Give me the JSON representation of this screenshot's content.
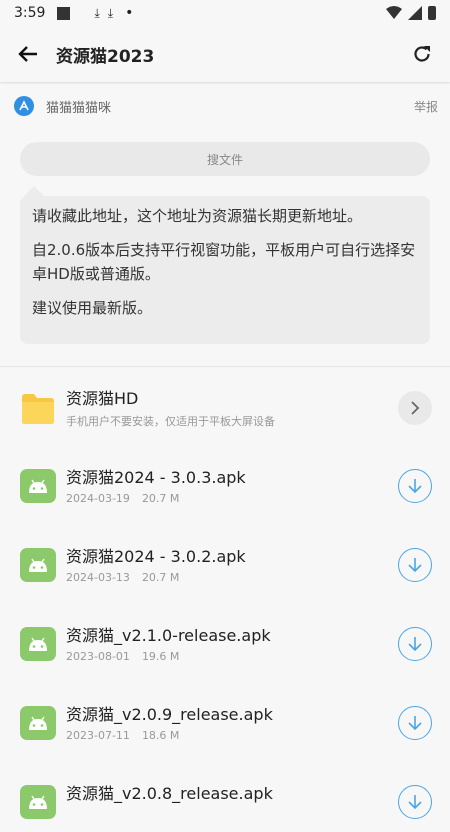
{
  "status_bar": {
    "time": "3:59",
    "dl1": "⤓",
    "dl2": "⤓",
    "dot": "•"
  },
  "appbar": {
    "title": "资源猫2023"
  },
  "author": {
    "name": "猫猫猫猫咪",
    "report": "举报"
  },
  "search": {
    "placeholder": "搜文件"
  },
  "notice": {
    "p1": "请收藏此地址，这个地址为资源猫长期更新地址。",
    "p2": "自2.0.6版本后支持平行视窗功能，平板用户可自行选择安卓HD版或普通版。",
    "p3": "建议使用最新版。"
  },
  "folder": {
    "name": "资源猫HD",
    "desc": "手机用户不要安装，仅适用于平板大屏设备"
  },
  "files": [
    {
      "name": "资源猫2024 - 3.0.3.apk",
      "date": "2024-03-19",
      "size": "20.7 M"
    },
    {
      "name": "资源猫2024 - 3.0.2.apk",
      "date": "2024-03-13",
      "size": "20.7 M"
    },
    {
      "name": "资源猫_v2.1.0-release.apk",
      "date": "2023-08-01",
      "size": "19.6 M"
    },
    {
      "name": "资源猫_v2.0.9_release.apk",
      "date": "2023-07-11",
      "size": "18.6 M"
    },
    {
      "name": "资源猫_v2.0.8_release.apk",
      "date": "",
      "size": ""
    }
  ],
  "colors": {
    "accent": "#4aa6e6",
    "apk_green": "#8bc96a",
    "folder_yellow": "#f7c843"
  }
}
